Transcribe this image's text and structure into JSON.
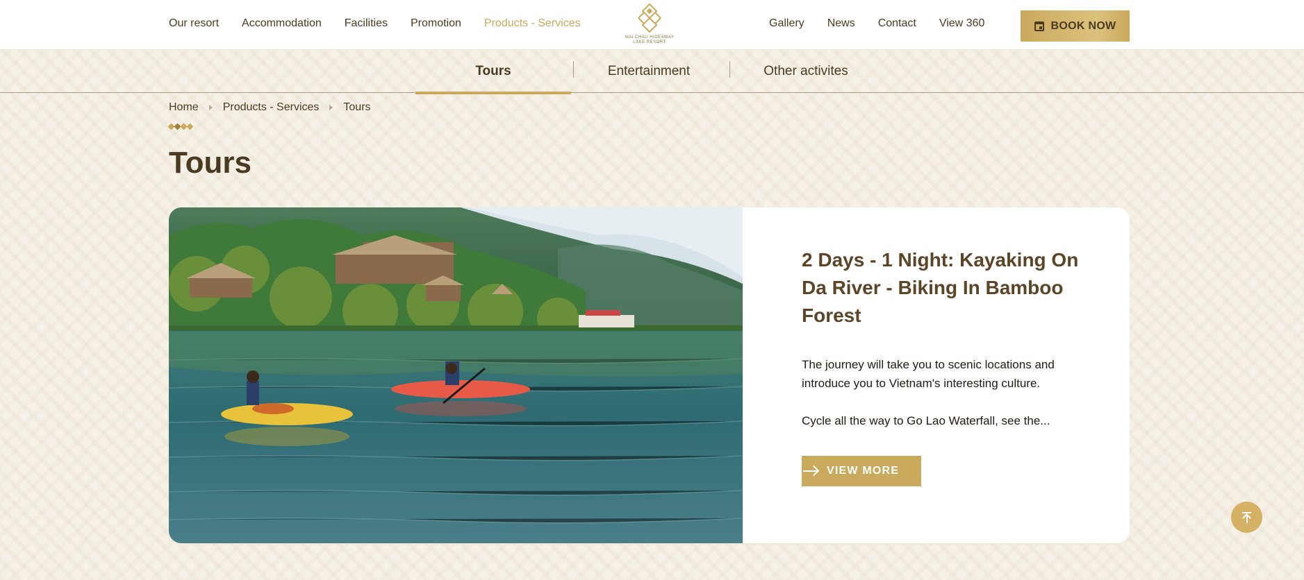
{
  "nav": {
    "left": [
      {
        "label": "Our resort"
      },
      {
        "label": "Accommodation"
      },
      {
        "label": "Facilities"
      },
      {
        "label": "Promotion"
      },
      {
        "label": "Products - Services",
        "active": true
      }
    ],
    "right": [
      {
        "label": "Gallery"
      },
      {
        "label": "News"
      },
      {
        "label": "Contact"
      },
      {
        "label": "View 360"
      }
    ],
    "book_label": "BOOK NOW"
  },
  "logo": {
    "line1": "MAI CHAU HIDEAWAY",
    "line2": "LAKE RESORT"
  },
  "subtabs": [
    {
      "label": "Tours",
      "active": true
    },
    {
      "label": "Entertainment"
    },
    {
      "label": "Other activites"
    }
  ],
  "breadcrumb": [
    "Home",
    "Products - Services",
    "Tours"
  ],
  "page_title": "Tours",
  "card": {
    "title": "2 Days - 1 Night: Kayaking On Da River - Biking In Bamboo Forest",
    "description": "The journey will take you to scenic locations and introduce you to Vietnam's interesting culture.",
    "description2": "Cycle all the way to Go Lao Waterfall, see the...",
    "button_label": "VIEW MORE",
    "image_alt": "kayakers on lake in front of resort"
  },
  "colors": {
    "accent": "#c9a95c",
    "text": "#4a3a22",
    "background": "#f6f1e7"
  },
  "icons": {
    "book": "calendar-icon",
    "view_more": "arrow-right-icon",
    "scroll": "arrow-up-icon"
  }
}
